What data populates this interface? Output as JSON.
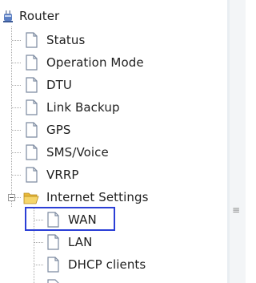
{
  "tree": {
    "root": {
      "label": "Router",
      "icon": "router-icon"
    },
    "items": [
      {
        "label": "Status",
        "icon": "document-icon"
      },
      {
        "label": "Operation Mode",
        "icon": "document-icon"
      },
      {
        "label": "DTU",
        "icon": "document-icon"
      },
      {
        "label": "Link Backup",
        "icon": "document-icon"
      },
      {
        "label": "GPS",
        "icon": "document-icon"
      },
      {
        "label": "SMS/Voice",
        "icon": "document-icon"
      },
      {
        "label": "VRRP",
        "icon": "document-icon"
      }
    ],
    "folder": {
      "label": "Internet Settings",
      "icon": "folder-open-icon",
      "expanded": true,
      "children": [
        {
          "label": "WAN",
          "icon": "document-icon",
          "selected": true
        },
        {
          "label": "LAN",
          "icon": "document-icon"
        },
        {
          "label": "DHCP clients",
          "icon": "document-icon"
        }
      ]
    }
  },
  "colors": {
    "selection_border": "#2b3fd6",
    "tree_line": "#a8a8a8",
    "folder": "#f2c84b",
    "panel_edge": "#e9eef2"
  },
  "scrollbar": {
    "grip_icon": "grip-icon",
    "grip_glyph": "≡"
  }
}
